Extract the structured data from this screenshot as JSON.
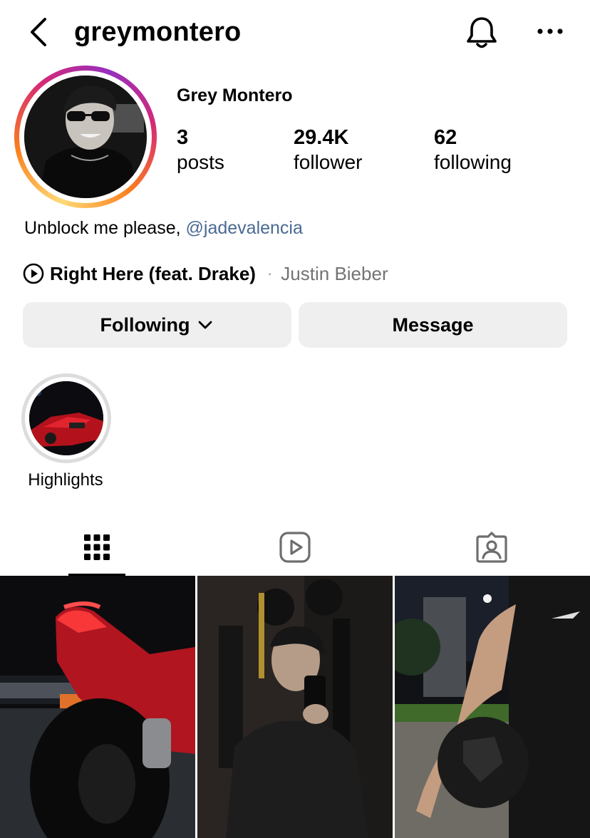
{
  "header": {
    "username": "greymontero",
    "back_icon": "chevron-left-icon",
    "bell_icon": "bell-icon",
    "more_icon": "more-horizontal-icon"
  },
  "profile": {
    "full_name": "Grey Montero",
    "stats": [
      {
        "value": "3",
        "label": "posts"
      },
      {
        "value": "29.4K",
        "label": "follower"
      },
      {
        "value": "62",
        "label": "following"
      }
    ],
    "bio_text": "Unblock me please,",
    "bio_mention": "@jadevalencia",
    "music": {
      "icon": "play-circle-icon",
      "title": "Right Here (feat. Drake)",
      "separator": "·",
      "artist": "Justin Bieber"
    }
  },
  "actions": {
    "following_label": "Following",
    "following_icon": "chevron-down-icon",
    "message_label": "Message"
  },
  "highlights": [
    {
      "label": "Highlights"
    }
  ],
  "tabs": [
    {
      "name": "grid",
      "icon": "grid-icon",
      "active": true
    },
    {
      "name": "reels",
      "icon": "reels-icon",
      "active": false
    },
    {
      "name": "tagged",
      "icon": "tagged-person-icon",
      "active": false
    }
  ],
  "posts": [
    {
      "subject": "red motorcycle at night"
    },
    {
      "subject": "mirror selfie in gym"
    },
    {
      "subject": "person holding football at night"
    }
  ],
  "colors": {
    "mention": "#4a6a93",
    "button_bg": "#efefef",
    "secondary_text": "#737373"
  }
}
